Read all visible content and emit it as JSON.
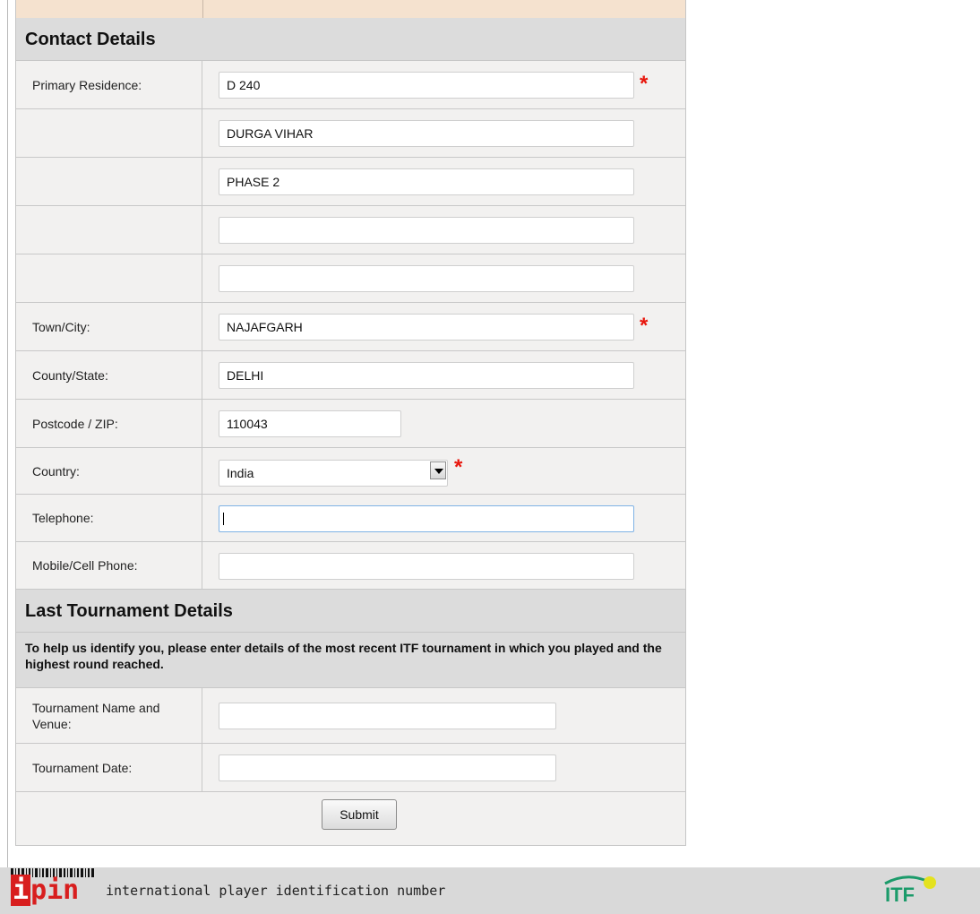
{
  "contact_section": {
    "title": "Contact Details",
    "primary_residence_label": "Primary Residence:",
    "address_line_1": "D 240",
    "address_line_2": "DURGA VIHAR",
    "address_line_3": "PHASE 2",
    "address_line_4": "",
    "address_line_5": "",
    "town_label": "Town/City:",
    "town_value": "NAJAFGARH",
    "state_label": "County/State:",
    "state_value": "DELHI",
    "postcode_label": "Postcode / ZIP:",
    "postcode_value": "110043",
    "country_label": "Country:",
    "country_value": "India",
    "telephone_label": "Telephone:",
    "telephone_value": "",
    "mobile_label": "Mobile/Cell Phone:",
    "mobile_value": "",
    "required_marker": "*"
  },
  "tournament_section": {
    "title": "Last Tournament Details",
    "info": "To help us identify you, please enter details of the most recent ITF tournament in which you played and the highest round reached.",
    "name_label": "Tournament Name and Venue:",
    "name_value": "",
    "date_label": "Tournament Date:",
    "date_value": ""
  },
  "submit_label": "Submit",
  "footer": {
    "logo_i": "i",
    "logo_pin": "pin",
    "tagline": "international player identification number",
    "itf_logo_text": "ITF",
    "ipin_color": "#d81e1e",
    "itf_color": "#1b9b6a",
    "ball_color": "#e4e21f"
  }
}
